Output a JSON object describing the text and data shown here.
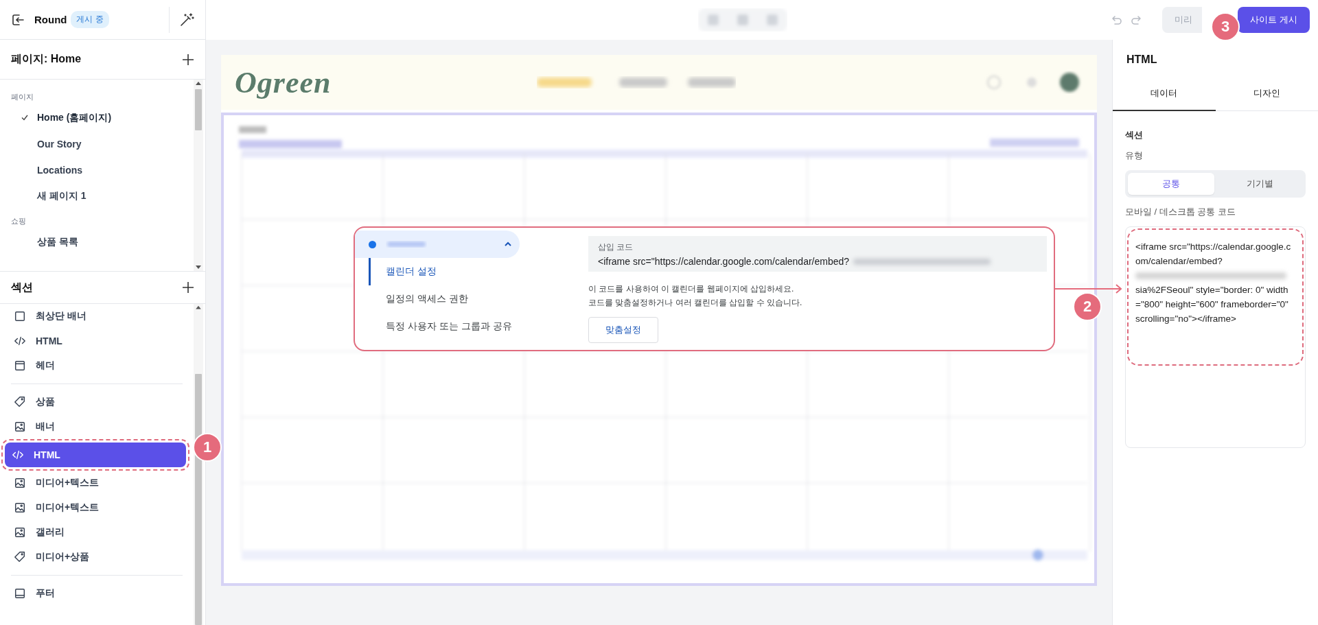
{
  "app": {
    "site_name": "Round",
    "status_badge": "게시 중"
  },
  "toolbar": {
    "preview_button": "미리",
    "publish_button": "사이트 게시"
  },
  "pages_panel": {
    "title": "페이지: Home",
    "groups": [
      {
        "label": "페이지",
        "items": [
          {
            "label": "Home (홈페이지)",
            "selected": true
          },
          {
            "label": "Our Story",
            "selected": false
          },
          {
            "label": "Locations",
            "selected": false
          },
          {
            "label": "새 페이지 1",
            "selected": false
          }
        ]
      },
      {
        "label": "쇼핑",
        "items": [
          {
            "label": "상품 목록",
            "selected": false
          }
        ]
      }
    ]
  },
  "sections_panel": {
    "title": "섹션",
    "groups": [
      {
        "items": [
          {
            "label": "최상단 배너",
            "kind": "frame",
            "selected": false
          },
          {
            "label": "HTML",
            "kind": "code",
            "selected": false
          },
          {
            "label": "헤더",
            "kind": "header",
            "selected": false
          }
        ]
      },
      {
        "items": [
          {
            "label": "상품",
            "kind": "tag",
            "selected": false
          },
          {
            "label": "배너",
            "kind": "image",
            "selected": false
          },
          {
            "label": "HTML",
            "kind": "code",
            "selected": true
          },
          {
            "label": "미디어+텍스트",
            "kind": "image",
            "selected": false
          },
          {
            "label": "미디어+텍스트",
            "kind": "image",
            "selected": false
          },
          {
            "label": "갤러리",
            "kind": "image",
            "selected": false
          },
          {
            "label": "미디어+상품",
            "kind": "tag",
            "selected": false
          }
        ]
      },
      {
        "items": [
          {
            "label": "푸터",
            "kind": "footer",
            "selected": false
          }
        ]
      }
    ]
  },
  "preview": {
    "logo": "Ogreen"
  },
  "embed_dialog": {
    "nav": [
      {
        "label": "캘린더 설정",
        "selected": true
      },
      {
        "label": "일정의 액세스 권한",
        "selected": false
      },
      {
        "label": "특정 사용자 또는 그룹과 공유",
        "selected": false
      }
    ],
    "code_label": "삽입 코드",
    "code": "<iframe src=\"https://calendar.google.com/calendar/embed?",
    "help": [
      "이 코드를 사용하여 이 캘린더를 웹페이지에 삽입하세요.",
      "코드를 맞춤설정하거나 여러 캘린더를 삽입할 수 있습니다."
    ],
    "customize_button": "맞춤설정"
  },
  "inspector": {
    "title": "HTML",
    "tabs": [
      {
        "label": "데이터",
        "selected": true
      },
      {
        "label": "디자인",
        "selected": false
      }
    ],
    "section_label": "섹션",
    "type_label": "유형",
    "segments": [
      {
        "label": "공통",
        "selected": true
      },
      {
        "label": "기기별",
        "selected": false
      }
    ],
    "code_label": "모바일 / 데스크톱 공통 코드",
    "code_before": "<iframe src=\"https://calendar.google.com/calendar/embed?",
    "code_after": "sia%2FSeoul\" style=\"border: 0\" width=\"800\" height=\"600\" frameborder=\"0\" scrolling=\"no\"></iframe>"
  },
  "callouts": [
    {
      "number": "1"
    },
    {
      "number": "2"
    },
    {
      "number": "3"
    }
  ]
}
